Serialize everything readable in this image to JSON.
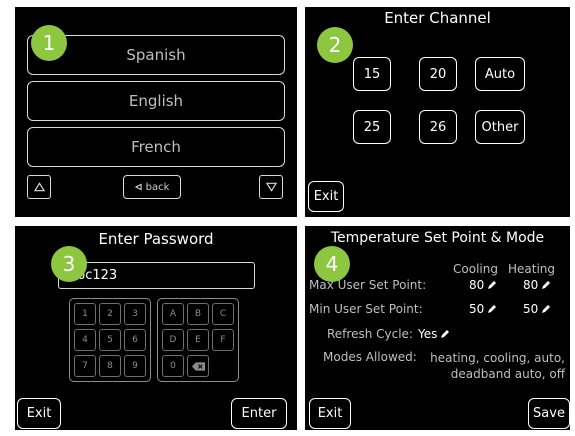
{
  "panel1": {
    "badge": "1",
    "languages": [
      "Spanish",
      "English",
      "French"
    ],
    "back_label": "back"
  },
  "panel2": {
    "badge": "2",
    "title": "Enter Channel",
    "channels": [
      "15",
      "20",
      "Auto",
      "25",
      "26",
      "Other"
    ],
    "exit_label": "Exit"
  },
  "panel3": {
    "badge": "3",
    "title": "Enter Password",
    "password_value": "abc123",
    "numeric_keys": [
      "1",
      "2",
      "3",
      "4",
      "5",
      "6",
      "7",
      "8",
      "9",
      "0"
    ],
    "letter_keys": [
      "A",
      "B",
      "C",
      "D",
      "E",
      "F"
    ],
    "exit_label": "Exit",
    "enter_label": "Enter"
  },
  "panel4": {
    "badge": "4",
    "title": "Temperature Set Point & Mode",
    "col_cooling": "Cooling",
    "col_heating": "Heating",
    "max_label": "Max User Set Point:",
    "max_cooling": "80",
    "max_heating": "80",
    "min_label": "Min User Set Point:",
    "min_cooling": "50",
    "min_heating": "50",
    "refresh_label": "Refresh Cycle:",
    "refresh_value": "Yes",
    "modes_label": "Modes Allowed:",
    "modes_line1": "heating, cooling, auto,",
    "modes_line2": "deadband auto, off",
    "exit_label": "Exit",
    "save_label": "Save"
  },
  "colors": {
    "badge_green": "#8dc63f",
    "panel_bg": "#000000"
  }
}
